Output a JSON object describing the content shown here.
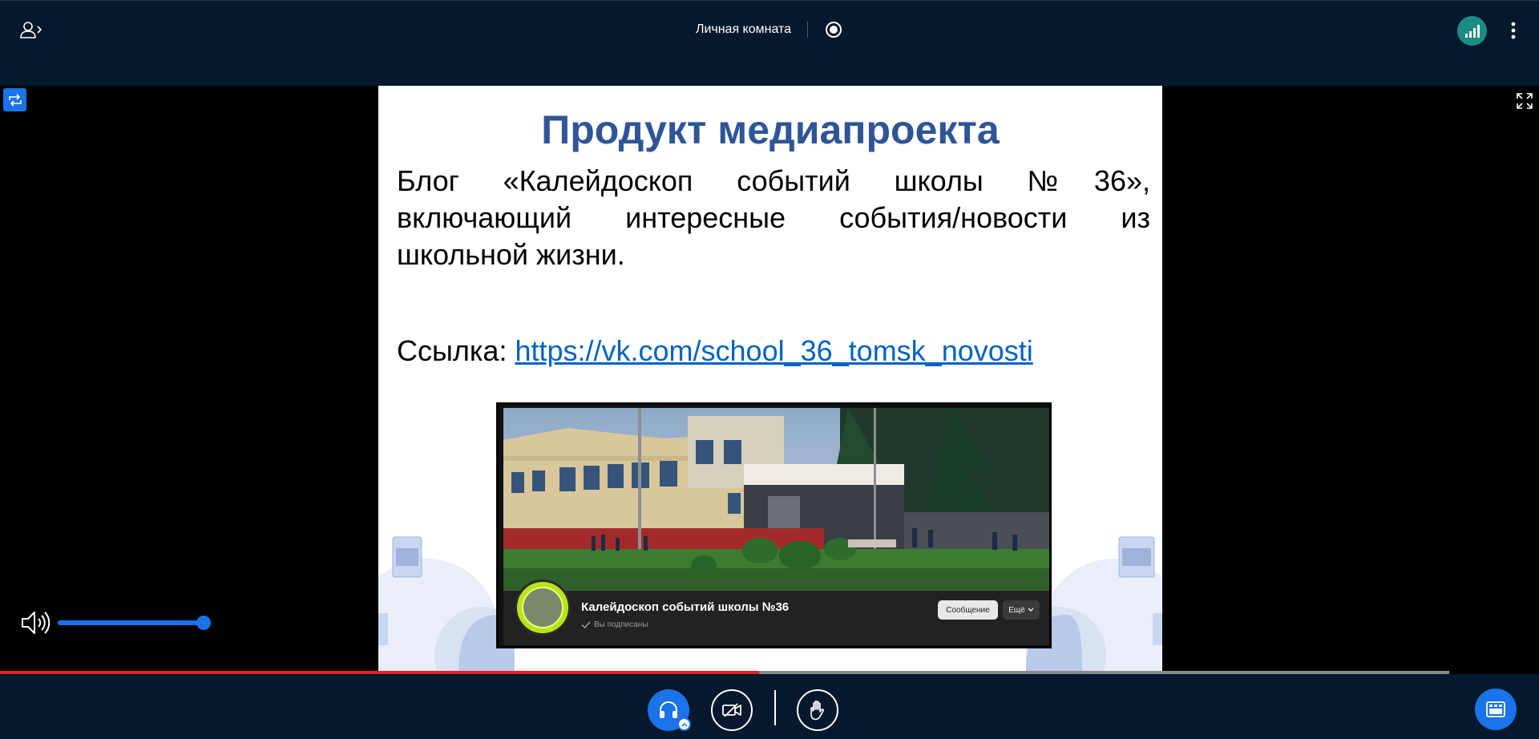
{
  "header": {
    "room_title": "Личная комната"
  },
  "slide": {
    "title": "Продукт медиапроекта",
    "body": "Блог «Калейдоскоп событий школы №36», включающий интересные события/новости из школьной жизни.",
    "link_label": "Ссылка: ",
    "link_url": "https://vk.com/school_36_tomsk_novosti",
    "card": {
      "community_name": "Калейдоскоп событий школы №36",
      "subscribed_text": "Вы подписаны",
      "message_button": "Сообщение",
      "more_button": "Ещё"
    }
  },
  "player": {
    "volume_percent": 100,
    "progress_percent": 52.4
  },
  "colors": {
    "accent": "#1a73e8",
    "background": "#06182d",
    "progress": "#e02424",
    "slide_title": "#2f5597",
    "connection": "#1b8b84"
  },
  "icons": {
    "users": "users-panel-icon",
    "record": "record-icon",
    "connection": "connection-status-icon",
    "more": "more-vertical-icon",
    "swap": "swap-presentation-icon",
    "fullscreen": "fullscreen-icon",
    "volume": "volume-icon",
    "audio": "headphones-icon",
    "video": "video-off-icon",
    "hand": "raise-hand-icon",
    "layout": "layout-icon"
  }
}
